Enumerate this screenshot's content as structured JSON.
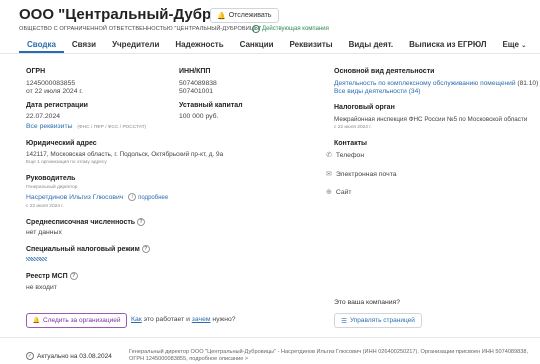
{
  "header": {
    "title": "ООО \"Центральный-Дубровицы\"",
    "track_label": "Отслеживать",
    "full_name": "ОБЩЕСТВО С ОГРАНИЧЕННОЙ ОТВЕТСТВЕННОСТЬЮ \"ЦЕНТРАЛЬНЫЙ-ДУБРОВИЦЫ\"",
    "status": "Действующая компания"
  },
  "tabs": [
    "Сводка",
    "Связи",
    "Учредители",
    "Надежность",
    "Санкции",
    "Реквизиты",
    "Виды деят.",
    "Выписка из ЕГРЮЛ",
    "Еще"
  ],
  "left": {
    "ogrn_label": "ОГРН",
    "ogrn_value": "1245000083855",
    "ogrn_date": "от 22 июля 2024 г.",
    "inn_label": "ИНН/КПП",
    "inn_value": "5074089838",
    "kpp_value": "507401001",
    "reg_label": "Дата регистрации",
    "reg_value": "22.07.2024",
    "all_req": "Все реквизиты",
    "all_req_note": "(ФНС / ПФР / ФСС / РОССТАТ)",
    "capital_label": "Уставный капитал",
    "capital_value": "100 000 руб.",
    "address_label": "Юридический адрес",
    "address_value": "142117, Московская область, г. Подольск, Октябрьский пр-кт, д. 9а",
    "address_note": "Еще 1 организация по этому адресу",
    "head_label": "Руководитель",
    "head_role": "Генеральный директор",
    "head_name": "Насретдинов Ильгиз Глюсович",
    "head_more": "подробнее",
    "head_date": "с 22 июля 2024 г.",
    "employees_label": "Среднесписочная численность",
    "employees_value": "нет данных",
    "tax_label": "Специальный налоговый режим",
    "msp_label": "Реестр МСП",
    "msp_value": "не входит"
  },
  "right": {
    "activity_label": "Основной вид деятельности",
    "activity_value": "Деятельность по комплексному обслуживанию помещений",
    "activity_code": "(81.10)",
    "all_activities": "Все виды деятельности",
    "all_activities_count": "(34)",
    "tax_org_label": "Налоговый орган",
    "tax_org_value": "Межрайонная инспекция ФНС России №5 по Московской области",
    "tax_org_date": "с 22 июля 2024 г.",
    "contacts_label": "Контакты",
    "phone": "Телефон",
    "email": "Электронная почта",
    "site": "Сайт"
  },
  "actions": {
    "follow": "Следить за организацией",
    "how": "Как",
    "how_rest": "это работает и",
    "why": "зачем",
    "why_rest": "нужно?",
    "owner_question": "Это ваша компания?",
    "manage": "Управлять страницей"
  },
  "footer": {
    "actual": "Актуально на 03.08.2024",
    "text": "Генеральный директор ООО \"Центральный-Дубровицы\" - Насретдинов Ильгиз Глюсович (ИНН 026400250217). Организации присвоен ИНН 5074089838, ОГРН 1245000083855, подробное описание >"
  }
}
